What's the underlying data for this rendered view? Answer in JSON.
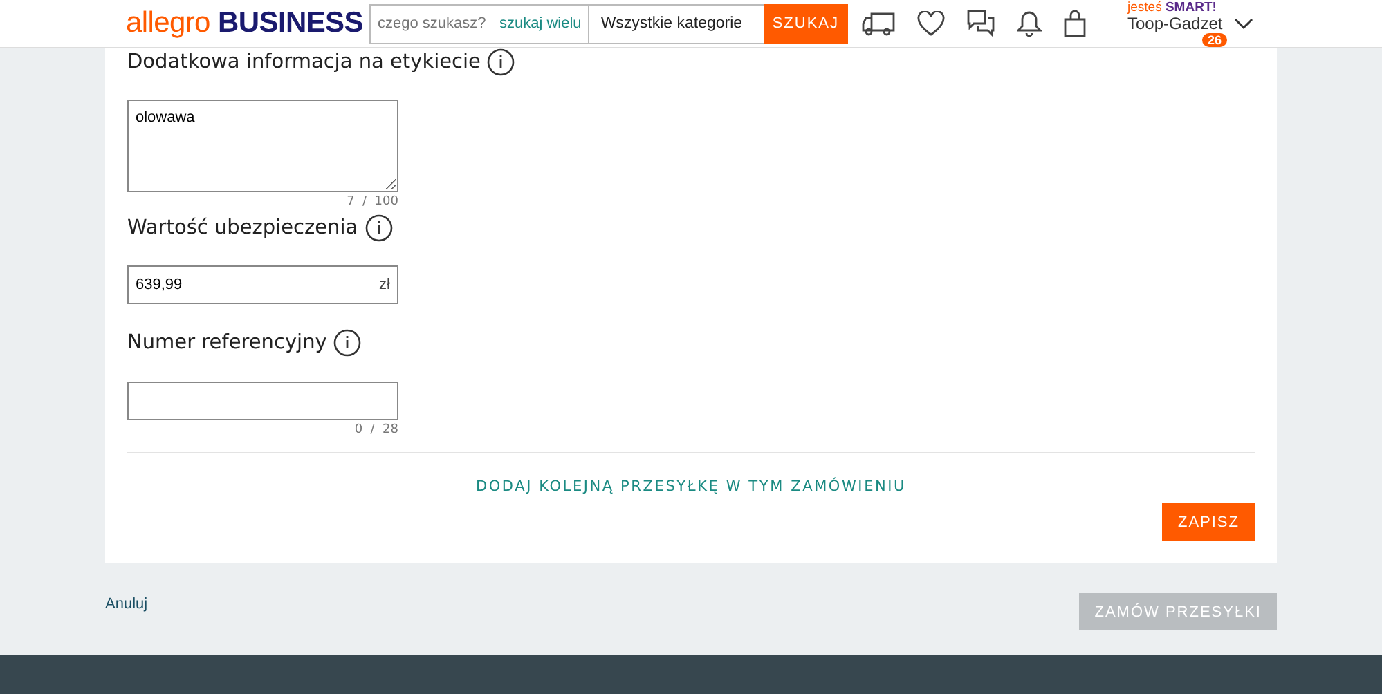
{
  "header": {
    "logo_left": "allegro",
    "logo_right": "BUSINESS",
    "search": {
      "placeholder": "czego szukasz?",
      "multi_link": "szukaj wielu",
      "category": "Wszystkie kategorie",
      "button": "SZUKAJ"
    },
    "smart_label_left": "jesteś",
    "smart_label_right": "SMART!",
    "user": "Toop-Gadzet",
    "badge": "26"
  },
  "fields": [
    {
      "label": "Dodatkowa informacja na etykiecie",
      "kind": "textarea",
      "value": "olowawa",
      "counter": "7  /  100"
    },
    {
      "label": "Wartość ubezpieczenia",
      "kind": "currency",
      "value": "639,99",
      "suffix": "zł"
    },
    {
      "label": "Numer referencyjny",
      "kind": "text",
      "counter": "0  /  28"
    }
  ],
  "add_link": "DODAJ KOLEJNĄ PRZESYŁKĘ W TYM ZAMÓWIENIU",
  "save_button": "ZAPISZ",
  "cancel_link": "Anuluj",
  "order_button": {
    "label": "ZAMÓW PRZESYŁKI",
    "disabled": true
  }
}
